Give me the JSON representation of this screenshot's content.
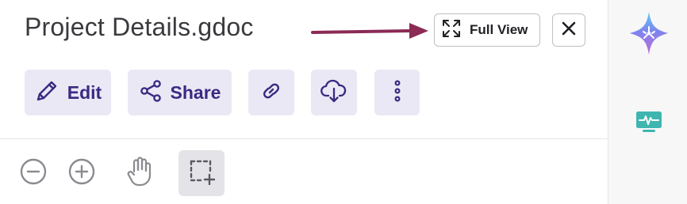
{
  "header": {
    "title": "Project Details.gdoc",
    "full_view_label": "Full View",
    "annotation_arrow_color": "#8b2a55"
  },
  "actions": [
    {
      "label": "Edit",
      "icon": "pencil-icon"
    },
    {
      "label": "Share",
      "icon": "share-icon"
    },
    {
      "label": "",
      "icon": "link-icon"
    },
    {
      "label": "",
      "icon": "cloud-download-icon"
    },
    {
      "label": "",
      "icon": "more-vertical-icon"
    }
  ],
  "tools": [
    {
      "icon": "zoom-out-icon",
      "active": false
    },
    {
      "icon": "zoom-in-icon",
      "active": false
    },
    {
      "icon": "hand-icon",
      "active": false
    },
    {
      "icon": "area-select-icon",
      "active": true
    }
  ],
  "rail": [
    {
      "icon": "ai-sparkle-icon"
    },
    {
      "icon": "monitor-pulse-icon"
    }
  ],
  "colors": {
    "accent_bg": "#ebe8f5",
    "accent_fg": "#3a2a82",
    "rail_teal": "#3fb5b0"
  }
}
